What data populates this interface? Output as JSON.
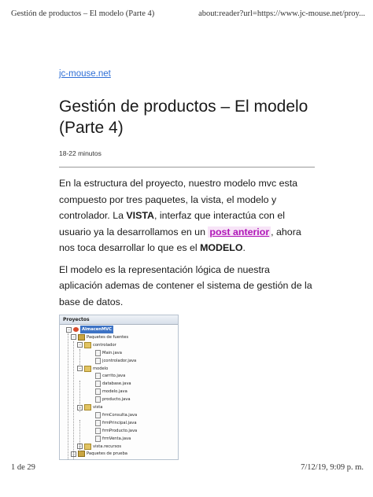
{
  "header": {
    "title": "Gestión de productos – El modelo (Parte 4)",
    "url": "about:reader?url=https://www.jc-mouse.net/proy..."
  },
  "article": {
    "site": "jc-mouse.net",
    "title": "Gestión de productos – El modelo (Parte 4)",
    "reading_time": "18-22 minutos",
    "p1": {
      "t1": "En la estructura del proyecto, nuestro modelo mvc esta compuesto por tres paquetes, la vista, el modelo y controlador. La ",
      "b1": "VISTA",
      "t2": ", interfaz que interactúa con el usuario ya la desarrollamos en un ",
      "link": "post anterior",
      "t3": ", ahora nos toca desarrollar lo que es el ",
      "b2": "MODELO",
      "t4": "."
    },
    "p2": "El modelo es la representación lógica de nuestra aplicación ademas de contener el sistema de gestión de la base de datos."
  },
  "figure": {
    "panel_title": "Proyectos",
    "nodes": [
      {
        "label": "AlmacenMVC",
        "icon": "project-icon"
      },
      {
        "label": "Paquetes de fuentes",
        "icon": "source-packages-icon"
      },
      {
        "label": "controlador",
        "icon": "package-icon"
      },
      {
        "label": "Main.java",
        "icon": "java-file-icon"
      },
      {
        "label": "jcontrolador.java",
        "icon": "java-file-icon"
      },
      {
        "label": "modelo",
        "icon": "package-icon"
      },
      {
        "label": "carrito.java",
        "icon": "java-file-icon"
      },
      {
        "label": "database.java",
        "icon": "java-file-icon"
      },
      {
        "label": "modelo.java",
        "icon": "java-file-icon"
      },
      {
        "label": "producto.java",
        "icon": "java-file-icon"
      },
      {
        "label": "vista",
        "icon": "package-icon"
      },
      {
        "label": "frmConsulta.java",
        "icon": "java-file-icon"
      },
      {
        "label": "frmPrincipal.java",
        "icon": "java-file-icon"
      },
      {
        "label": "frmProducto.java",
        "icon": "java-file-icon"
      },
      {
        "label": "frmVenta.java",
        "icon": "java-file-icon"
      },
      {
        "label": "vista.recursos",
        "icon": "package-icon"
      },
      {
        "label": "Paquetes de prueba",
        "icon": "source-packages-icon"
      }
    ]
  },
  "footer": {
    "page": "1 de 29",
    "datetime": "7/12/19, 9:09 p. m."
  }
}
